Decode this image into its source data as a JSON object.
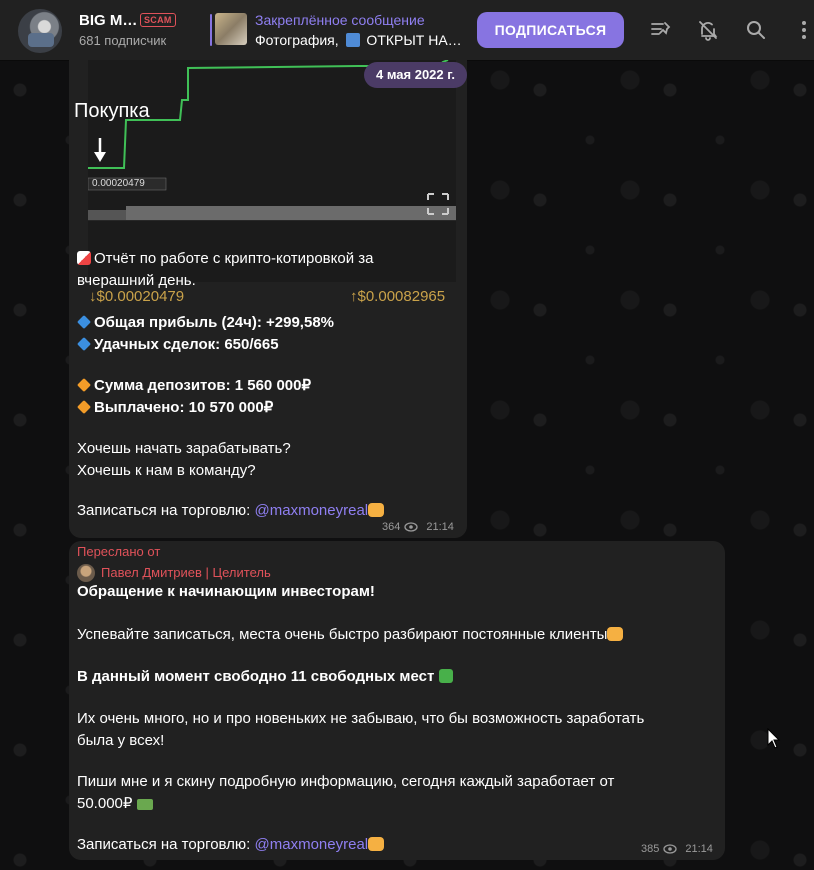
{
  "header": {
    "channel_title": "BIG M…",
    "scam_badge": "SCAM",
    "subscribers": "681 подписчик",
    "pinned_label": "Закреплённое сообщение",
    "pinned_text": "Фотография, ",
    "pinned_text_tail": " ОТКРЫТ НА…",
    "subscribe_button": "ПОДПИСАТЬСЯ"
  },
  "message1": {
    "chart_annotation": "Покупка",
    "chart_price_tag": "0.00020479",
    "date_pill": "4 мая 2022 г.",
    "price_low": "↓$0.00020479",
    "price_high": "↑$0.00082965",
    "lines": [
      "Отчёт по работе с крипто-котировкой за",
      "вчерашний день.",
      "Общая прибыль (24ч): +299,58%",
      "Удачных сделок: 650/665",
      "Сумма депозитов: 1 560 000₽",
      "Выплачено: 10 570 000₽",
      "Хочешь начать зарабатывать?",
      "Хочешь к нам в команду?",
      "Записаться на торговлю: "
    ],
    "link": "@maxmoneyreal",
    "views": "364",
    "time": "21:14"
  },
  "message2": {
    "forwarded_label": "Переслано от",
    "forwarded_from": "Павел Дмитриев | Целитель",
    "lines": [
      "Обращение к начинающим инвесторам!",
      "Успевайте записаться, места очень быстро разбирают постоянные клиенты",
      "В данный момент свободно 11 свободных мест",
      "Их очень много, но и про новеньких не забываю, что бы возможность заработать",
      "была у всех!",
      "Пиши мне и я скину подробную информацию, сегодня каждый заработает от",
      "50.000₽",
      "Записаться на торговлю: "
    ],
    "link": "@maxmoneyreal",
    "views": "385",
    "time": "21:14"
  },
  "colors": {
    "accent": "#8774e1",
    "bubble": "#212121",
    "link": "#8f7ff1",
    "forward": "#e0525a",
    "price": "#c9a24a"
  }
}
